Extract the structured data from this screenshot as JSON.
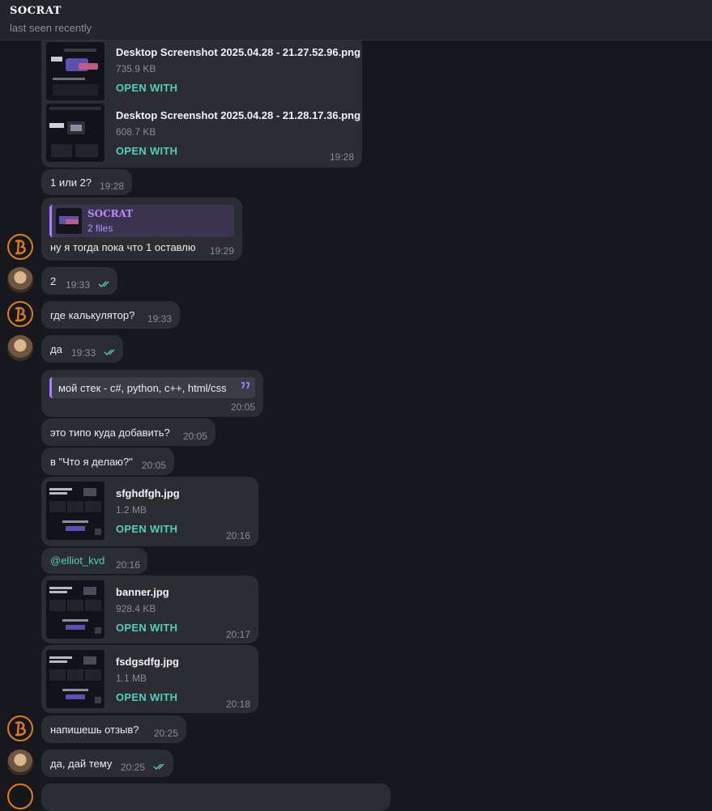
{
  "header": {
    "title": "SOCRAT",
    "status": "last seen recently"
  },
  "messages": {
    "files1": {
      "items": [
        {
          "name": "Desktop Screenshot 2025.04.28 - 21.27.52.96.png",
          "size": "735.9 KB",
          "action": "OPEN WITH"
        },
        {
          "name": "Desktop Screenshot 2025.04.28 - 21.28.17.36.png",
          "size": "608.7 KB",
          "action": "OPEN WITH"
        }
      ],
      "time": "19:28"
    },
    "m1": {
      "text": "1 или 2?",
      "time": "19:28"
    },
    "m2": {
      "reply_name": "SOCRAT",
      "reply_sub": "2 files",
      "text": "ну я тогда пока что 1 оставлю",
      "time": "19:29"
    },
    "m3": {
      "text": "2",
      "time": "19:33"
    },
    "m4": {
      "text": "где калькулятор?",
      "time": "19:33"
    },
    "m5": {
      "text": "да",
      "time": "19:33"
    },
    "m6": {
      "quote": "мой стек - c#, python, c++, html/css",
      "time": "20:05"
    },
    "m7": {
      "text": "это типо куда добавить?",
      "time": "20:05"
    },
    "m8": {
      "text": "в \"Что я делаю?\"",
      "time": "20:05"
    },
    "m9": {
      "name": "sfghdfgh.jpg",
      "size": "1.2 MB",
      "action": "OPEN WITH",
      "time": "20:16"
    },
    "m10": {
      "text": "@elliot_kvd",
      "time": "20:16"
    },
    "m11": {
      "name": "banner.jpg",
      "size": "928.4 KB",
      "action": "OPEN WITH",
      "time": "20:17"
    },
    "m12": {
      "name": "fsdgsdfg.jpg",
      "size": "1.1 MB",
      "action": "OPEN WITH",
      "time": "20:18"
    },
    "m13": {
      "text": "напишешь отзыв?",
      "time": "20:25"
    },
    "m14": {
      "text": "да, дай тему",
      "time": "20:25"
    }
  },
  "colors": {
    "accent": "#4fd1b9",
    "reply_accent": "#a980ff",
    "bubble": "#2b2d33",
    "background": "#17181d"
  }
}
